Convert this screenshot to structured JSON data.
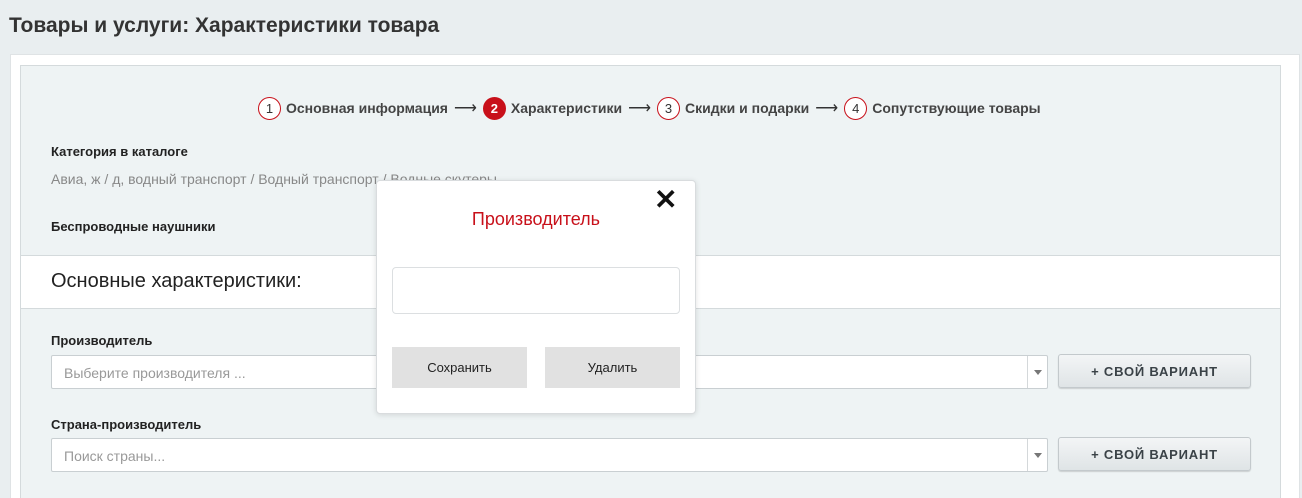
{
  "page": {
    "title": "Товары и услуги: Характеристики товара"
  },
  "steps": [
    {
      "num": "1",
      "label": "Основная информация"
    },
    {
      "num": "2",
      "label": "Характеристики"
    },
    {
      "num": "3",
      "label": "Скидки и подарки"
    },
    {
      "num": "4",
      "label": "Сопутствующие товары"
    }
  ],
  "step_arrow": "⟶",
  "active_step": 2,
  "category": {
    "label": "Категория в каталоге",
    "path": "Авиа, ж / д, водный транспорт / Водный транспорт / Водные скутеры"
  },
  "product_name": "Беспроводные наушники",
  "section_title": "Основные характеристики:",
  "fields": {
    "manufacturer": {
      "label": "Производитель",
      "placeholder": "Выберите производителя ...",
      "own_button": "+ СВОЙ ВАРИАНТ"
    },
    "country": {
      "label": "Страна-производитель",
      "placeholder": "Поиск страны...",
      "own_button": "+ СВОЙ ВАРИАНТ"
    }
  },
  "modal": {
    "title": "Производитель",
    "close": "✕",
    "input_value": "",
    "save_label": "Сохранить",
    "delete_label": "Удалить"
  },
  "colors": {
    "accent": "#c8101a"
  }
}
